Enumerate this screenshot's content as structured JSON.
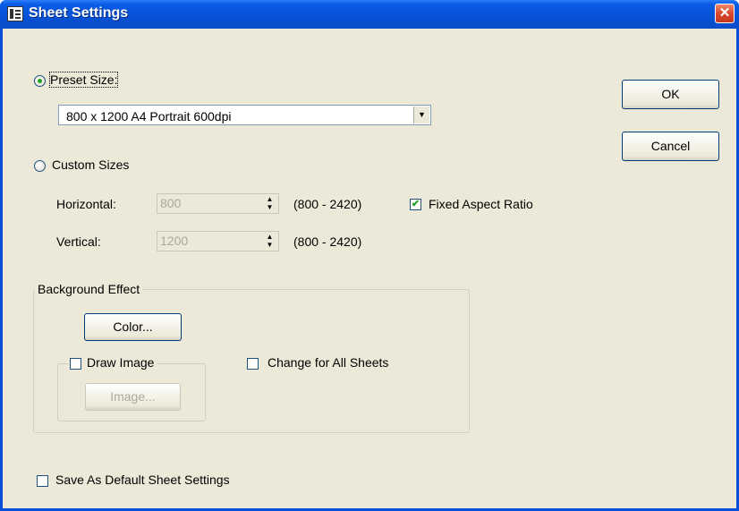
{
  "window": {
    "title": "Sheet Settings",
    "close_glyph": "✕"
  },
  "preset": {
    "radio_label": "Preset Size:",
    "selected": true,
    "combo_value": "800 x 1200 A4 Portrait 600dpi"
  },
  "custom": {
    "radio_label": "Custom Sizes",
    "selected": false,
    "horizontal_label": "Horizontal:",
    "horizontal_value": "800",
    "horizontal_range": "(800 - 2420)",
    "vertical_label": "Vertical:",
    "vertical_value": "1200",
    "vertical_range": "(800 - 2420)",
    "fixed_aspect_label": "Fixed Aspect Ratio",
    "fixed_aspect_checked": true
  },
  "background": {
    "group_title": "Background Effect",
    "color_button": "Color...",
    "draw_image_label": "Draw Image",
    "draw_image_checked": false,
    "image_button": "Image...",
    "change_all_label": "Change for All Sheets",
    "change_all_checked": false
  },
  "save_default": {
    "label": "Save As Default Sheet Settings",
    "checked": false
  },
  "buttons": {
    "ok": "OK",
    "cancel": "Cancel"
  },
  "icons": {
    "title_icon": "sheet-settings-app-icon",
    "close": "close-icon",
    "check_glyph": "✔"
  },
  "colors": {
    "titlebar": "#0752d6",
    "dialog_bg": "#ece9d8",
    "close_button": "#d8452b"
  }
}
